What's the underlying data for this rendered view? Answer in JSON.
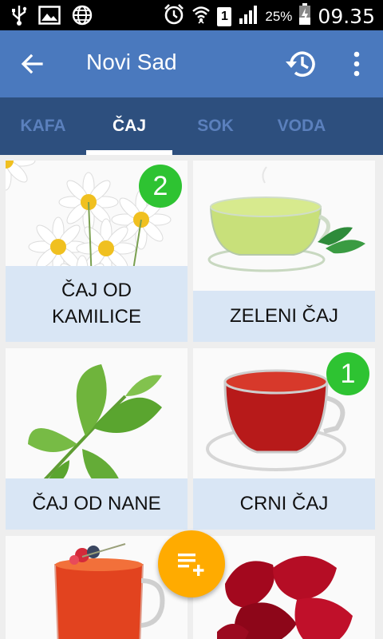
{
  "status_bar": {
    "battery_percent": "25%",
    "time": "09.35",
    "sim_slot": "1"
  },
  "app_bar": {
    "title": "Novi Sad"
  },
  "tabs": [
    {
      "label": "KAFA",
      "active": false
    },
    {
      "label": "ČAJ",
      "active": true
    },
    {
      "label": "SOK",
      "active": false
    },
    {
      "label": "VODA",
      "active": false
    }
  ],
  "items": [
    {
      "line1": "ČAJ OD",
      "line2": "KAMILICE",
      "count": "2",
      "image": "chamomile-flowers"
    },
    {
      "line1": "ZELENI ČAJ",
      "line2": "",
      "count": "",
      "image": "green-tea-cup"
    },
    {
      "line1": "ČAJ OD NANE",
      "line2": "",
      "count": "",
      "image": "mint-leaves"
    },
    {
      "line1": "CRNI ČAJ",
      "line2": "",
      "count": "1",
      "image": "black-tea-cup"
    },
    {
      "line1": "",
      "line2": "",
      "count": "",
      "image": "fruit-tea-mug"
    },
    {
      "line1": "",
      "line2": "",
      "count": "",
      "image": "hibiscus-flowers"
    }
  ],
  "colors": {
    "app_bar": "#4a79be",
    "tab_bar": "#2d4f7e",
    "badge": "#2ec332",
    "fab": "#ffab00",
    "label_bg": "#d9e6f5"
  }
}
